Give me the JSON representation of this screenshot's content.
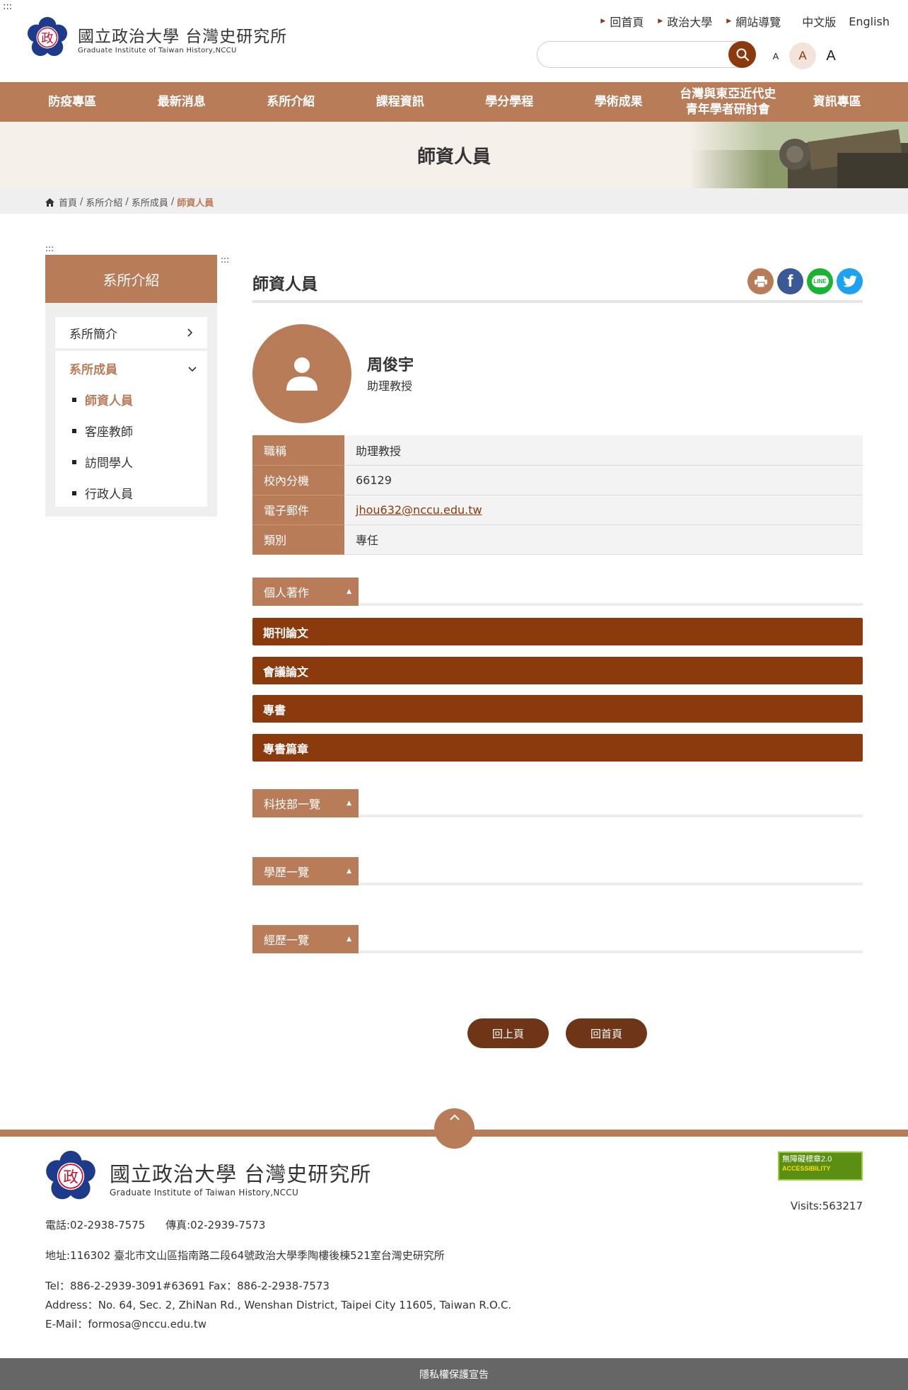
{
  "accesskey_mark": ":::",
  "header": {
    "logo_title": "國立政治大學  台灣史研究所",
    "logo_subtitle": "Graduate Institute of Taiwan History,NCCU",
    "seal_char": "政",
    "top_links": [
      "回首頁",
      "政治大學",
      "網站導覽"
    ],
    "lang_zh": "中文版",
    "lang_en": "English",
    "search_placeholder": "",
    "font_sizes": [
      "A",
      "A",
      "A"
    ]
  },
  "nav": [
    {
      "label": "防疫專區"
    },
    {
      "label": "最新消息"
    },
    {
      "label": "系所介紹"
    },
    {
      "label": "課程資訊"
    },
    {
      "label": "學分學程"
    },
    {
      "label": "學術成果"
    },
    {
      "label": "台灣與東亞近代史\n青年學者研討會"
    },
    {
      "label": "資訊專區"
    }
  ],
  "banner": {
    "title": "師資人員"
  },
  "breadcrumb": [
    "首頁",
    "系所介紹",
    "系所成員",
    "師資人員"
  ],
  "sidebar": {
    "mark": ":::",
    "mark2": ":::",
    "heading": "系所介紹",
    "item1": "系所簡介",
    "section": "系所成員",
    "subitems": [
      "師資人員",
      "客座教師",
      "訪問學人",
      "行政人員"
    ]
  },
  "page": {
    "title": "師資人員",
    "share": {
      "print": "print-icon",
      "facebook": "f",
      "line": "LINE",
      "twitter": "twitter-icon"
    }
  },
  "profile": {
    "name": "周俊宇",
    "title": "助理教授",
    "rows": [
      {
        "key": "職稱",
        "value": "助理教授"
      },
      {
        "key": "校內分機",
        "value": "66129"
      },
      {
        "key": "電子郵件",
        "value": "jhou632@nccu.edu.tw"
      },
      {
        "key": "類別",
        "value": "專任"
      }
    ]
  },
  "sections": {
    "publications": "個人著作",
    "publication_bars": [
      "期刊論文",
      "會議論文",
      "專書",
      "專書篇章"
    ],
    "nstc": "科技部一覽",
    "education": "學歷一覽",
    "experience": "經歷一覽"
  },
  "buttons": {
    "back": "回上頁",
    "home": "回首頁"
  },
  "footer": {
    "title": "國立政治大學  台灣史研究所",
    "subtitle": "Graduate Institute of Taiwan History,NCCU",
    "badge_line1": "無障礙標章2.0",
    "badge_line2": "ACCESSIBILITY",
    "visits": "Visits:563217",
    "phone": "電話:02-2938-7575",
    "fax": "傳真:02-2939-7573",
    "address_zh": "地址:116302 臺北市文山區指南路二段64號政治大學季陶樓後棟521室台灣史研究所",
    "tel_en": "Tel：886-2-2939-3091#63691    Fax：886-2-2938-7573",
    "address_en": "Address：No. 64, Sec. 2, ZhiNan Rd., Wenshan District, Taipei City 11605, Taiwan R.O.C.",
    "email_en": "E-Mail：formosa@nccu.edu.tw",
    "privacy": "隱私權保護宣告"
  },
  "colors": {
    "brand": "#b97c59",
    "dark": "#8b3a0e",
    "button": "#6e3616"
  }
}
